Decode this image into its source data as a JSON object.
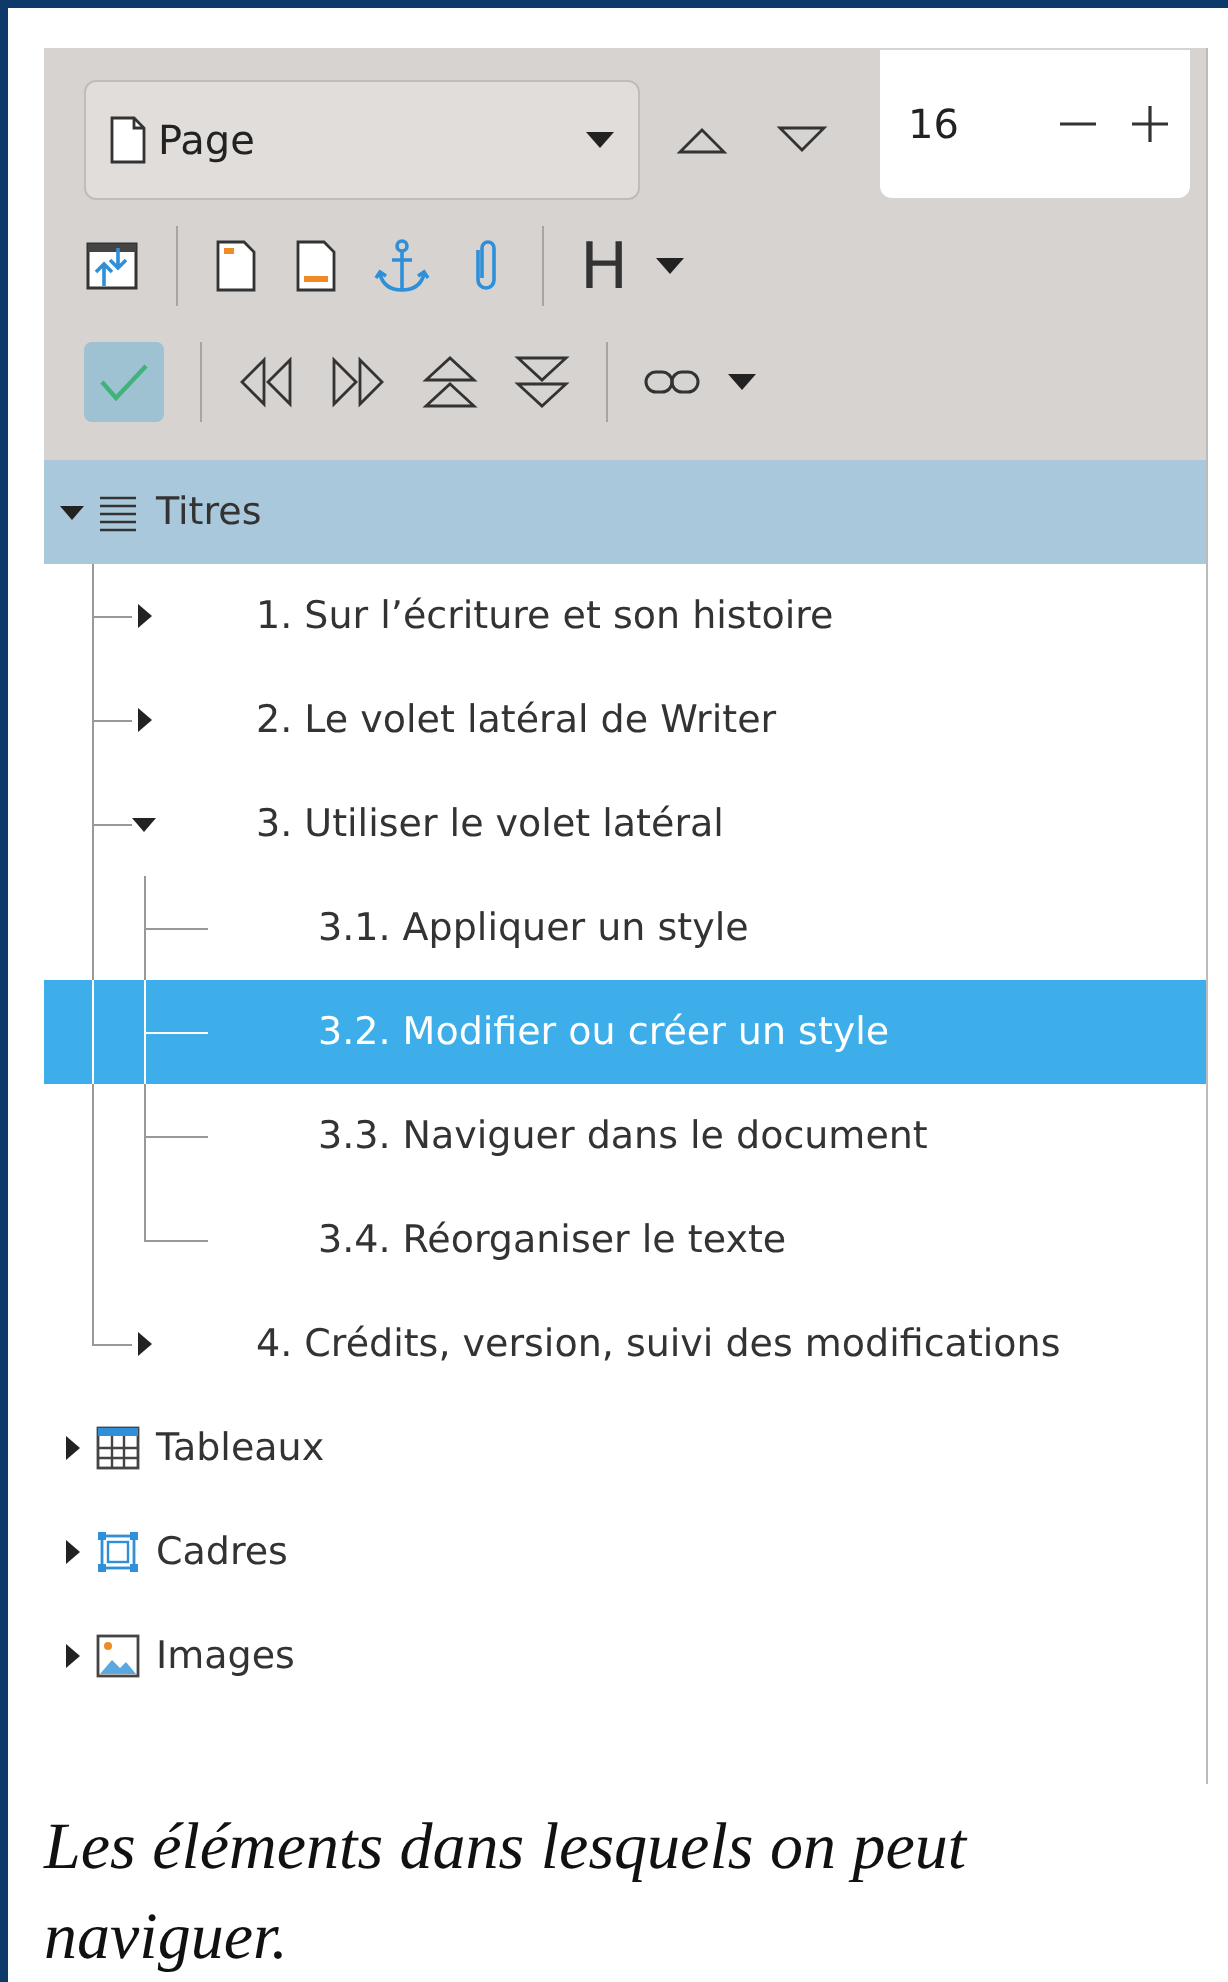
{
  "navigator": {
    "navigate_by": "Page",
    "page_number": "16",
    "heading_menu_label": "H",
    "content_navigation_checked": true
  },
  "tree": [
    {
      "label": "Titres",
      "kind": "headings",
      "expanded": true,
      "active": true,
      "selected": false,
      "children": [
        {
          "label": "1. Sur l’écriture et son histoire",
          "expanded": false,
          "selected": false
        },
        {
          "label": "2. Le volet latéral de Writer",
          "expanded": false,
          "selected": false
        },
        {
          "label": "3. Utiliser le volet latéral",
          "expanded": true,
          "selected": false,
          "children": [
            {
              "label": "3.1. Appliquer un style",
              "selected": false
            },
            {
              "label": "3.2. Modifier ou créer un style",
              "selected": true
            },
            {
              "label": "3.3. Naviguer dans le document",
              "selected": false
            },
            {
              "label": "3.4. Réorganiser le texte",
              "selected": false
            }
          ]
        },
        {
          "label": "4. Crédits, version, suivi des modifications",
          "expanded": false,
          "selected": false
        }
      ]
    },
    {
      "label": "Tableaux",
      "kind": "tables",
      "expanded": false,
      "active": false,
      "selected": false
    },
    {
      "label": "Cadres",
      "kind": "frames",
      "expanded": false,
      "active": false,
      "selected": false
    },
    {
      "label": "Images",
      "kind": "images",
      "expanded": false,
      "active": false,
      "selected": false
    }
  ],
  "caption": "Les éléments dans lesquels on peut naviguer."
}
